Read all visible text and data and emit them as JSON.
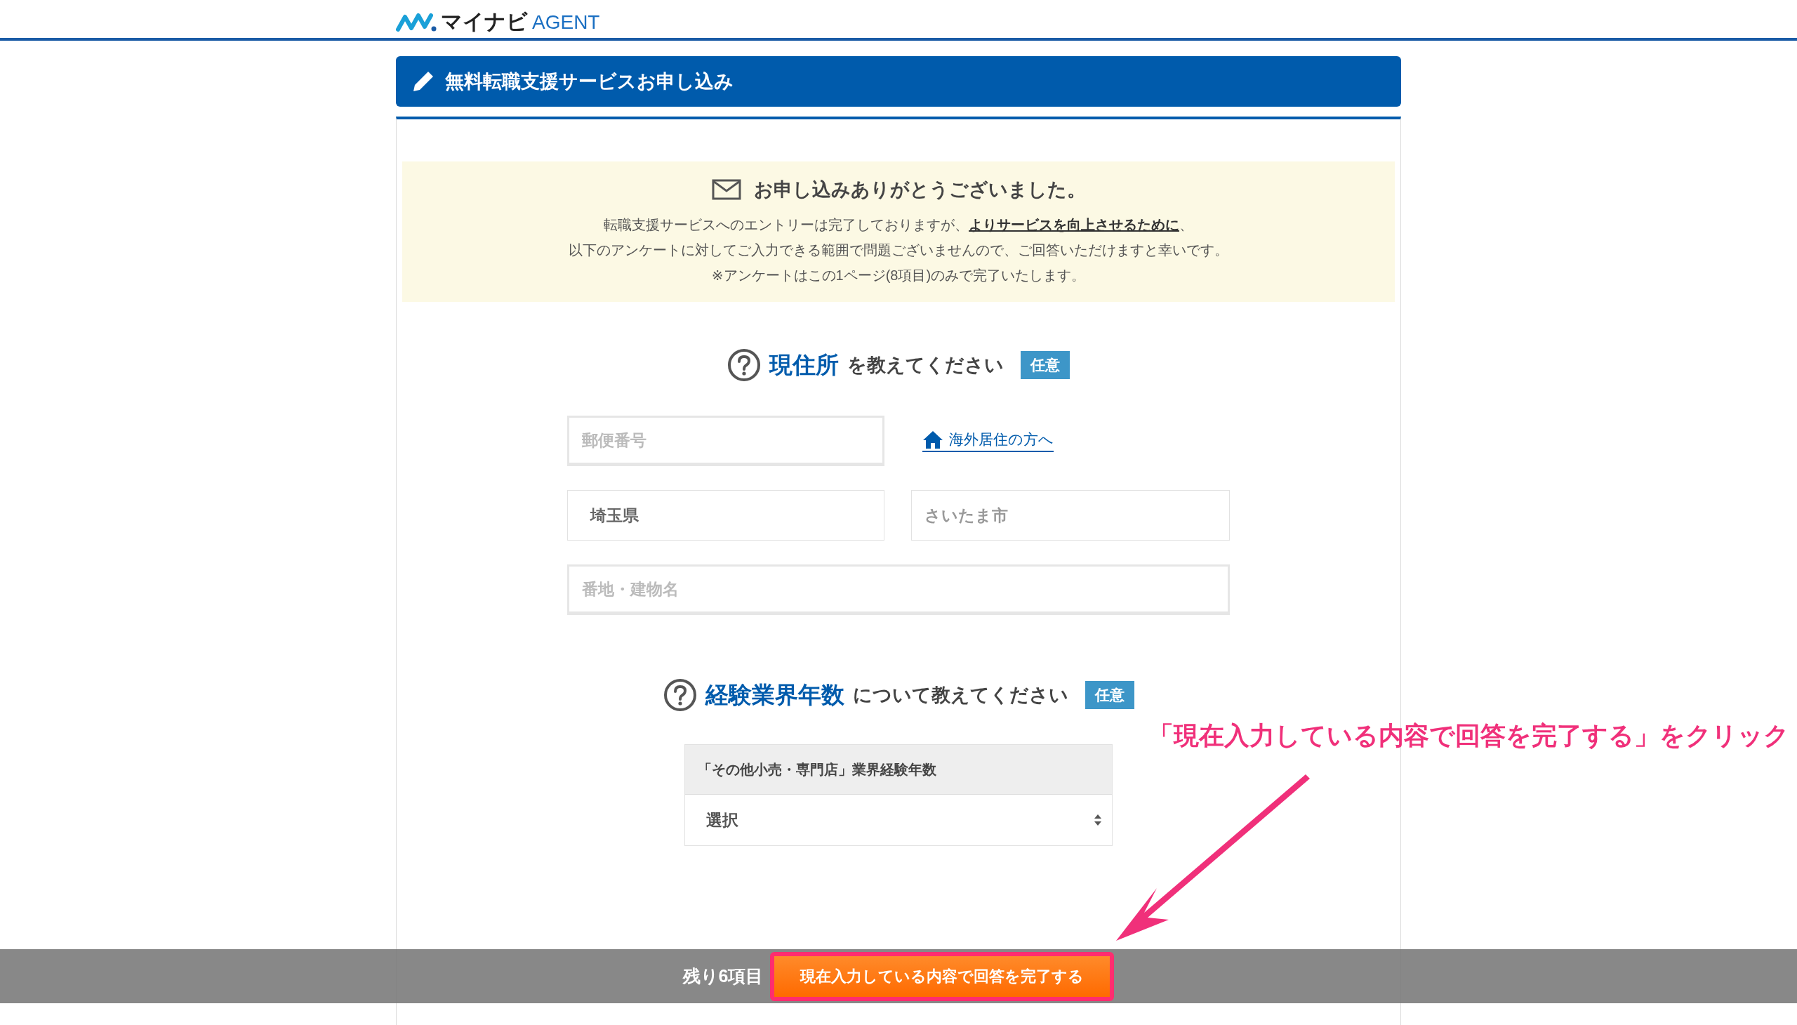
{
  "logo": {
    "brand": "マイナビ",
    "suffix": "AGENT"
  },
  "form_title": "無料転職支援サービスお申し込み",
  "notice": {
    "heading": "お申し込みありがとうございました。",
    "lines": [
      "転職支援サービスへのエントリーは完了しておりますが、**よりサービスを向上させるために**、",
      "以下のアンケートに対してご入力できる範囲で問題ございませんので、ご回答いただけますと幸いです。",
      "※アンケートはこの1ページ(8項目)のみで完了いたします。"
    ]
  },
  "questions": [
    {
      "highlight": "現住所",
      "text": "を教えてください",
      "badge": "任意",
      "kind": "address",
      "postal": {
        "placeholder": "郵便番号"
      },
      "overseas_link": "海外居住の方へ",
      "prefecture": {
        "value": "埼玉県"
      },
      "city": {
        "value": "さいたま市"
      },
      "street": {
        "placeholder": "番地・建物名"
      }
    },
    {
      "highlight": "経験業界年数",
      "text": "について教えてください",
      "badge": "任意",
      "kind": "select",
      "select_label": "「その他小売・専門店」業界経験年数",
      "select_value": "選択"
    }
  ],
  "annotation": "「現在入力している内容で回答を完了する」をクリック",
  "bottom_bar": {
    "remaining": "残り6項目",
    "submit": "現在入力している内容で回答を完了する"
  }
}
